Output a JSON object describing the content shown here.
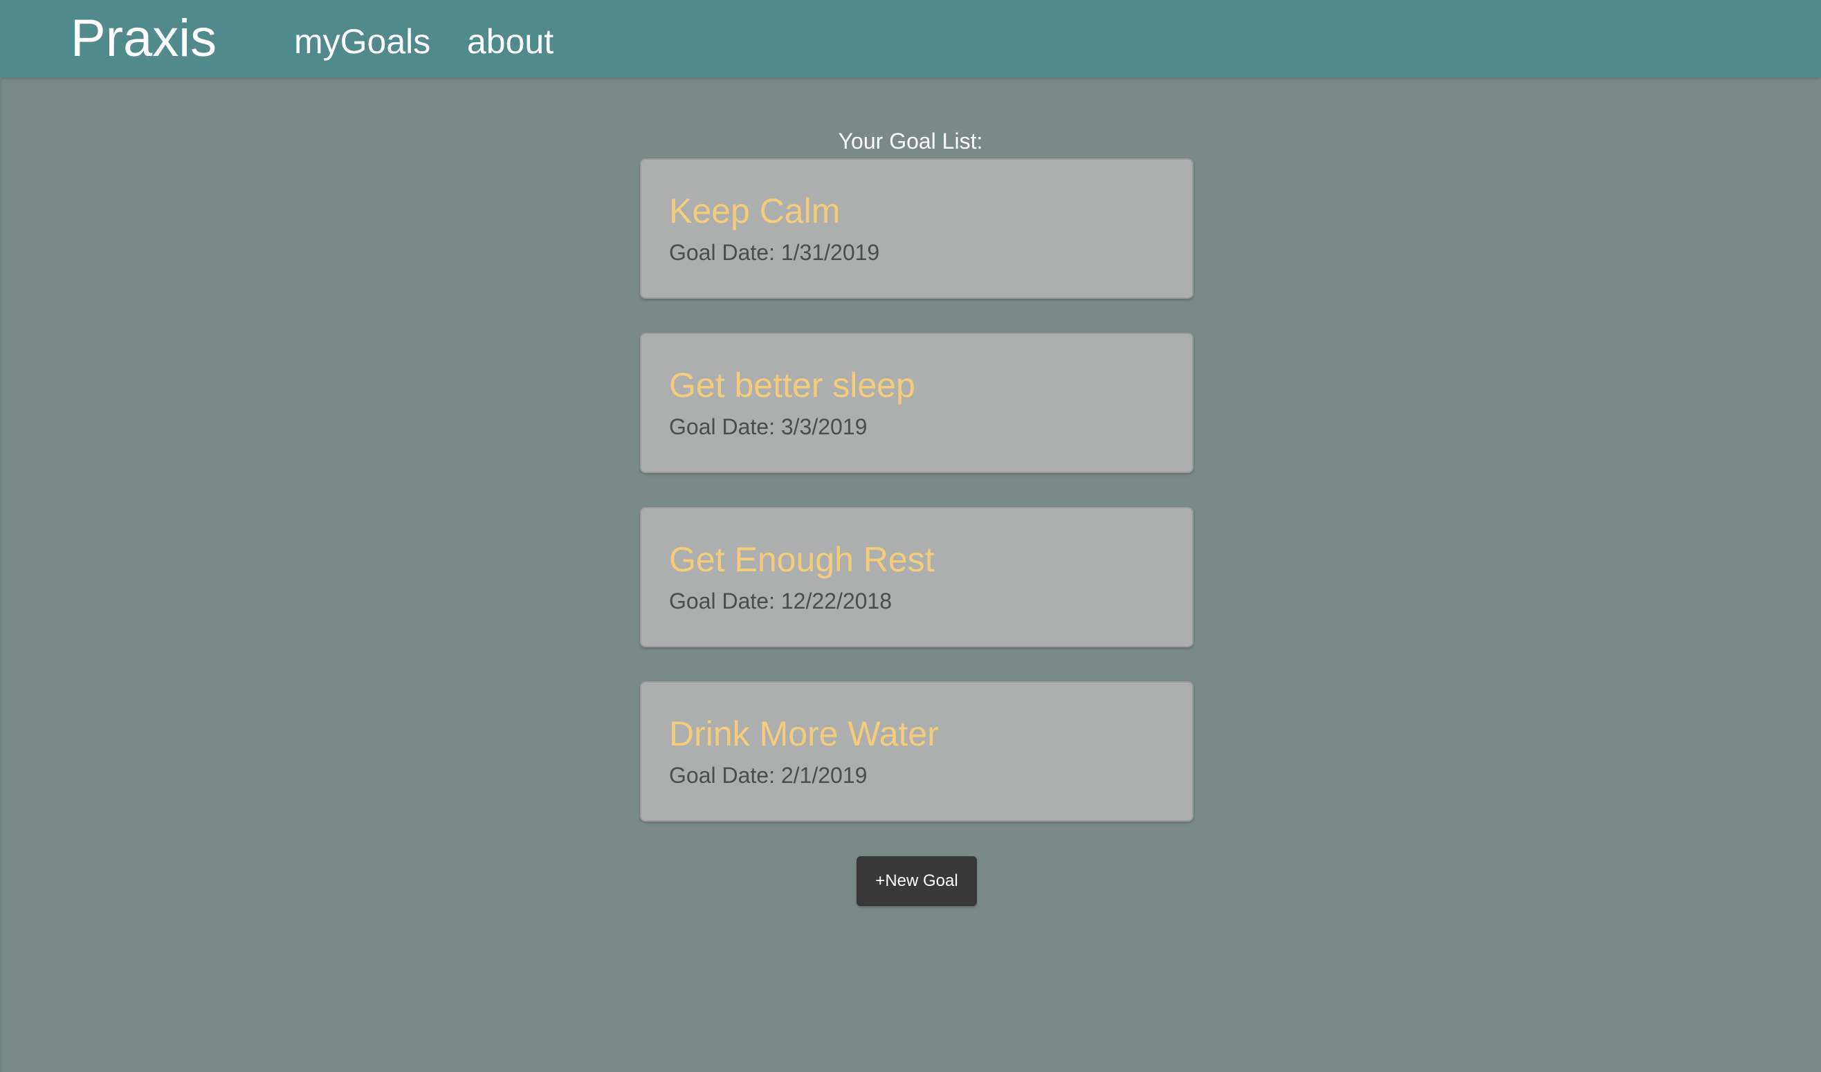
{
  "app": {
    "brand": "Praxis"
  },
  "nav": {
    "items": [
      {
        "label": "myGoals"
      },
      {
        "label": "about"
      }
    ]
  },
  "main": {
    "heading": "Your Goal List:",
    "goals": [
      {
        "title": "Keep Calm",
        "date": "Goal Date: 1/31/2019"
      },
      {
        "title": "Get better sleep",
        "date": "Goal Date: 3/3/2019"
      },
      {
        "title": "Get Enough Rest",
        "date": "Goal Date: 12/22/2018"
      },
      {
        "title": "Drink More Water",
        "date": "Goal Date: 2/1/2019"
      }
    ],
    "new_goal_label": "+New Goal"
  },
  "colors": {
    "navbar": "#518a8a",
    "background": "#7b8a89",
    "card": "#adafae",
    "goal_title": "#f3cd7b",
    "button": "#383838"
  }
}
